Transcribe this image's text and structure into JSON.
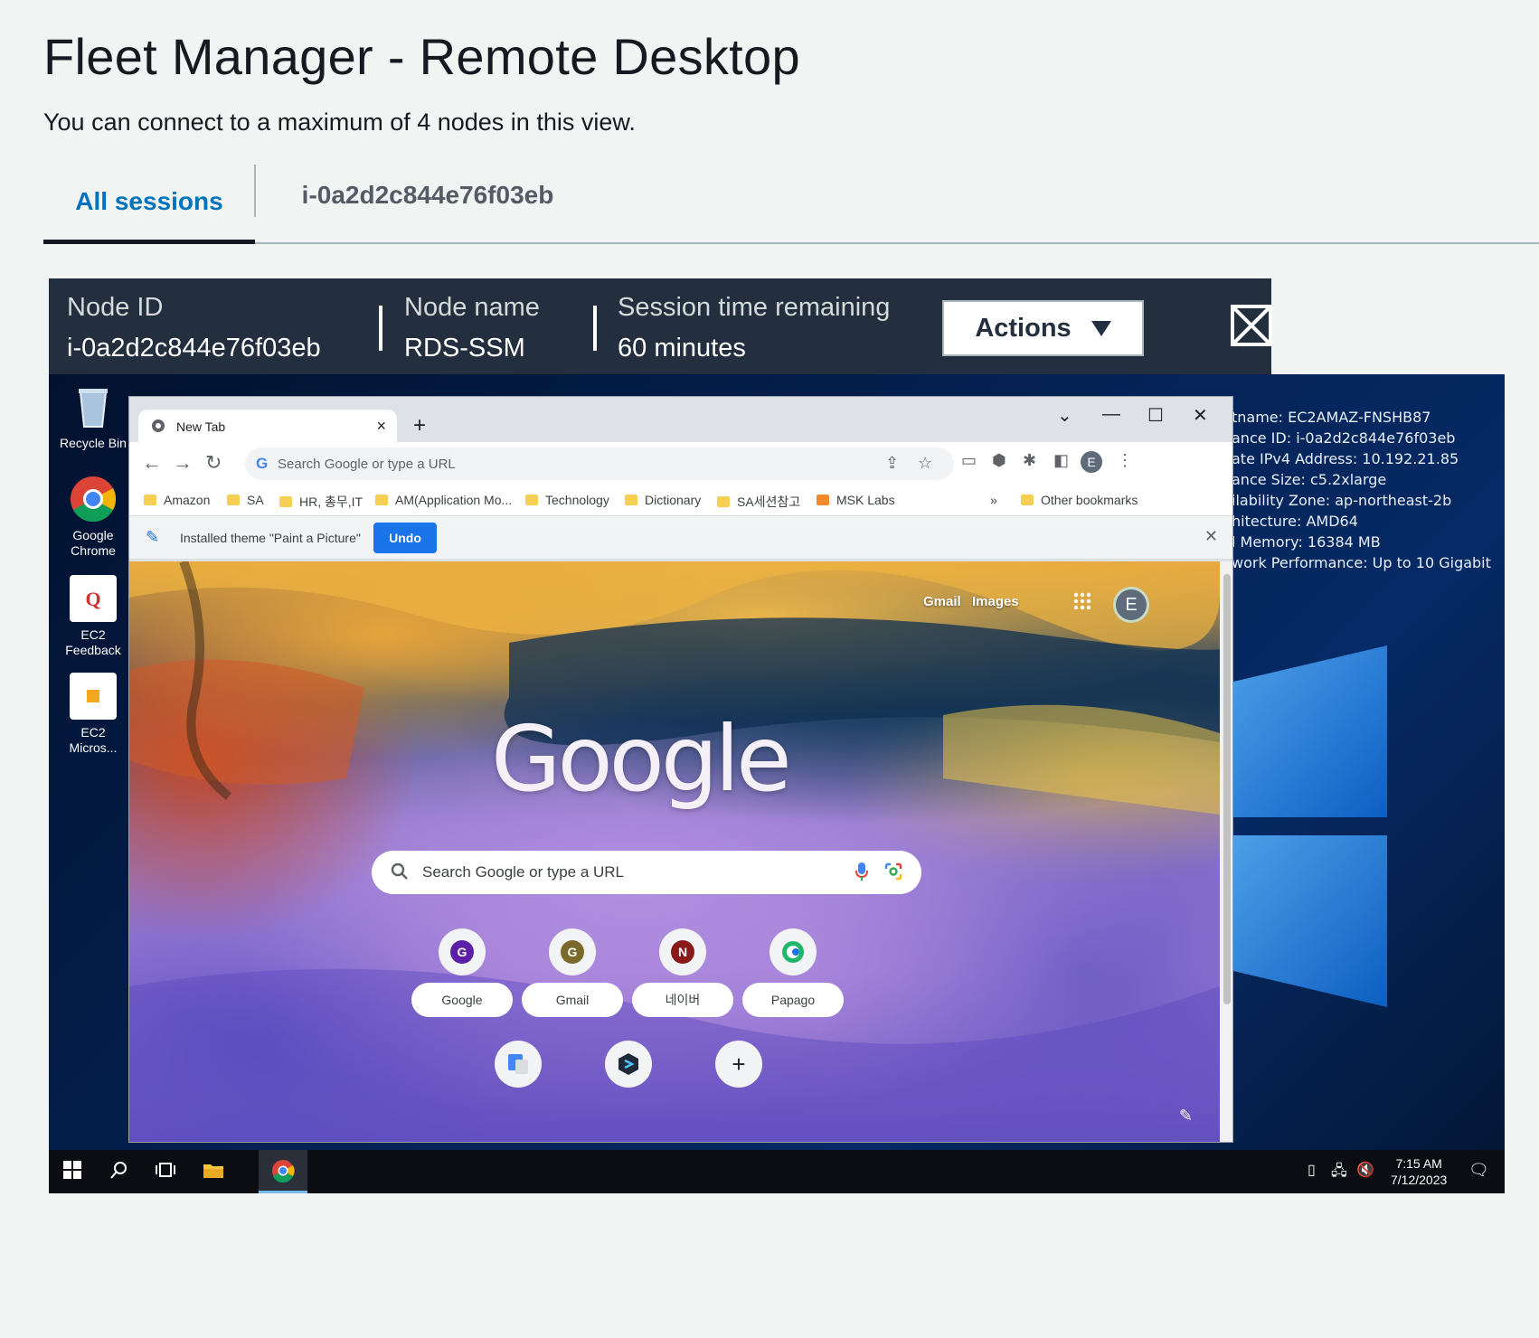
{
  "page": {
    "title": "Fleet Manager - Remote Desktop",
    "subtitle": "You can connect to a maximum of 4 nodes in this view."
  },
  "tabs": [
    {
      "label": "All sessions",
      "active": true
    },
    {
      "label": "i-0a2d2c844e76f03eb",
      "active": false
    }
  ],
  "session": {
    "node_id_label": "Node ID",
    "node_id_value": "i-0a2d2c844e76f03eb",
    "node_name_label": "Node name",
    "node_name_value": "RDS-SSM",
    "time_label": "Session time remaining",
    "time_value": "60 minutes",
    "actions_label": "Actions",
    "expand_icon": "expand-icon"
  },
  "desktop": {
    "icons": [
      {
        "label": "Recycle Bin",
        "icon": "recycle-bin-icon"
      },
      {
        "label": "Google\nChrome",
        "icon": "chrome-icon"
      },
      {
        "label": "EC2\nFeedback",
        "icon": "ec2-feedback-icon"
      },
      {
        "label": "EC2\nMicros...",
        "icon": "ec2-microsoft-icon"
      }
    ],
    "sysinfo": [
      "tname: EC2AMAZ-FNSHB87",
      "ance ID: i-0a2d2c844e76f03eb",
      "ate IPv4 Address: 10.192.21.85",
      "ance Size: c5.2xlarge",
      "ilability Zone: ap-northeast-2b",
      "hitecture: AMD64",
      "l Memory: 16384 MB",
      "work Performance: Up to 10 Gigabit"
    ]
  },
  "browser": {
    "tab_title": "New Tab",
    "omnibox_placeholder": "Search Google or type a URL",
    "bookmarks": [
      "Amazon",
      "SA",
      "HR, 총무,IT",
      "AM(Application Mo...",
      "Technology",
      "Dictionary",
      "SA세션참고",
      "MSK Labs"
    ],
    "bookmarks_overflow": "»",
    "other_bookmarks": "Other bookmarks",
    "infobar_text": "Installed theme \"Paint a Picture\"",
    "undo_label": "Undo",
    "profile_initial": "E"
  },
  "ntp": {
    "gmail_link": "Gmail",
    "images_link": "Images",
    "logo_text": "Google",
    "search_placeholder": "Search Google or type a URL",
    "shortcuts": [
      {
        "label": "Google",
        "letter": "G",
        "color": "#5b1fa8"
      },
      {
        "label": "Gmail",
        "letter": "G",
        "color": "#7a6a2a"
      },
      {
        "label": "네이버",
        "letter": "N",
        "color": "#8a1a1a"
      },
      {
        "label": "Papago",
        "letter": "",
        "color": "#1aa35a"
      }
    ],
    "profile_initial": "E"
  },
  "taskbar": {
    "time": "7:15 AM",
    "date": "7/12/2023"
  },
  "colors": {
    "aws_header": "#232f3e",
    "tab_active": "#0073bb",
    "undo_blue": "#1a73e8"
  }
}
